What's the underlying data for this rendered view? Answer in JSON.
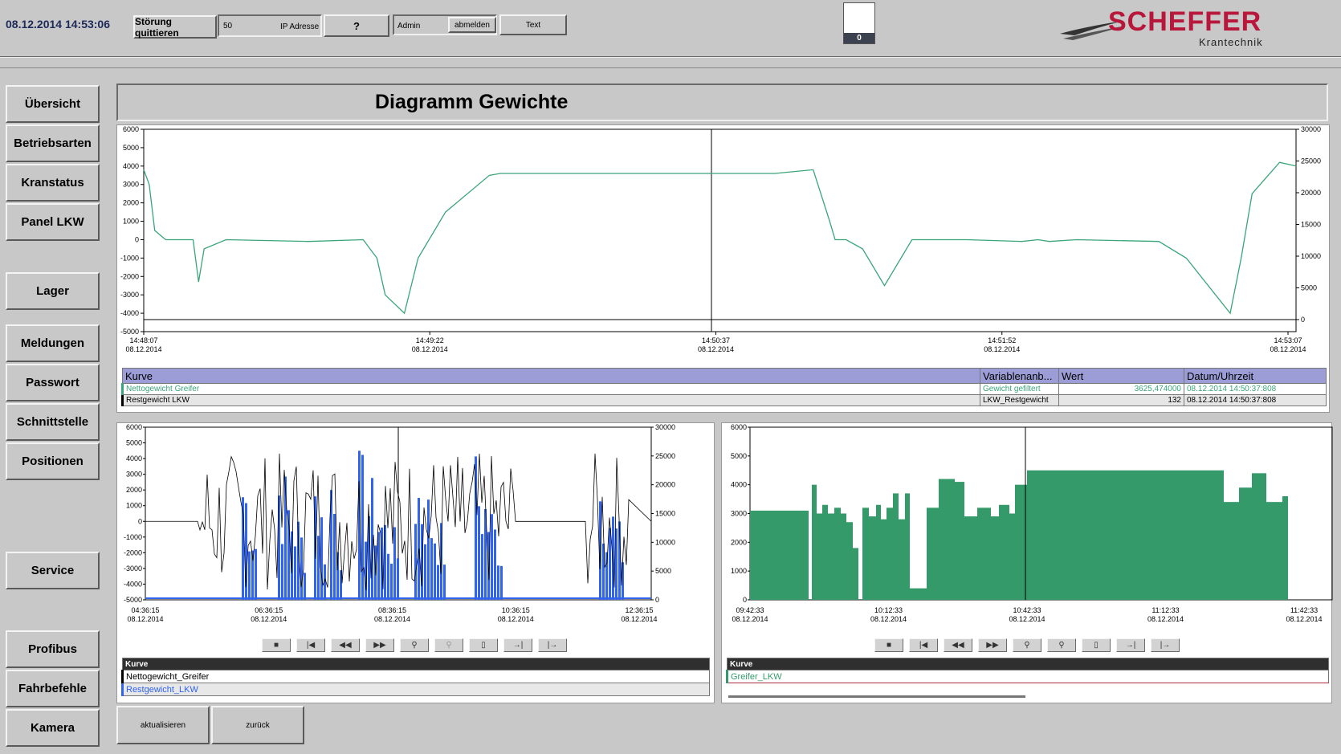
{
  "header": {
    "datetime": "08.12.2014 14:53:06",
    "ack_button": "Störung quittieren",
    "ip_value": "50",
    "ip_label": "IP Adresse",
    "help_button": "?",
    "user": "Admin",
    "logout_button": "abmelden",
    "text_button": "Text",
    "counter": "0",
    "logo_name": "SCHEFFER",
    "logo_sub": "Krantechnik"
  },
  "sidebar": {
    "items": [
      {
        "label": "Übersicht"
      },
      {
        "label": "Betriebsarten"
      },
      {
        "label": "Kranstatus"
      },
      {
        "label": "Panel LKW"
      },
      {
        "label": "Lager"
      },
      {
        "label": "Meldungen"
      },
      {
        "label": "Passwort"
      },
      {
        "label": "Schnittstelle"
      },
      {
        "label": "Positionen"
      },
      {
        "label": "Service"
      },
      {
        "label": "Profibus"
      },
      {
        "label": "Fahrbefehle"
      },
      {
        "label": "Kamera"
      }
    ]
  },
  "page_title": "Diagramm Gewichte",
  "top_chart": {
    "y_left_ticks": [
      "6000",
      "5000",
      "4000",
      "3000",
      "2000",
      "1000",
      "0",
      "-1000",
      "-2000",
      "-3000",
      "-4000",
      "-5000"
    ],
    "y_right_ticks": [
      "30000",
      "25000",
      "20000",
      "15000",
      "10000",
      "5000",
      "0"
    ],
    "x_ticks": [
      {
        "time": "14:48:07",
        "date": "08.12.2014"
      },
      {
        "time": "14:49:22",
        "date": "08.12.2014"
      },
      {
        "time": "14:50:37",
        "date": "08.12.2014"
      },
      {
        "time": "14:51:52",
        "date": "08.12.2014"
      },
      {
        "time": "14:53:07",
        "date": "08.12.2014"
      }
    ]
  },
  "top_legend": {
    "headers": [
      "Kurve",
      "Variablenanb...",
      "Wert",
      "Datum/Uhrzeit"
    ],
    "rows": [
      {
        "name": "Nettogewicht Greifer",
        "var": "Gewicht gefiltert",
        "value": "3625,474000",
        "datetime": "08.12.2014 14:50:37:808"
      },
      {
        "name": "Restgewicht LKW",
        "var": "LKW_Restgewicht",
        "value": "132",
        "datetime": "08.12.2014 14:50:37:808"
      }
    ]
  },
  "left_chart": {
    "y_left_ticks": [
      "6000",
      "5000",
      "4000",
      "3000",
      "2000",
      "1000",
      "0",
      "-1000",
      "-2000",
      "-3000",
      "-4000",
      "-5000"
    ],
    "y_right_ticks": [
      "30000",
      "25000",
      "20000",
      "15000",
      "10000",
      "5000",
      "0"
    ],
    "x_ticks": [
      {
        "time": "04:36:15",
        "date": "08.12.2014"
      },
      {
        "time": "06:36:15",
        "date": "08.12.2014"
      },
      {
        "time": "08:36:15",
        "date": "08.12.2014"
      },
      {
        "time": "10:36:15",
        "date": "08.12.2014"
      },
      {
        "time": "12:36:15",
        "date": "08.12.2014"
      }
    ],
    "legend_header": "Kurve",
    "legend": [
      "Nettogewicht_Greifer",
      "Restgewicht_LKW"
    ]
  },
  "right_chart": {
    "y_ticks": [
      "6000",
      "5000",
      "4000",
      "3000",
      "2000",
      "1000",
      "0"
    ],
    "x_ticks": [
      {
        "time": "09:42:33",
        "date": "08.12.2014"
      },
      {
        "time": "10:12:33",
        "date": "08.12.2014"
      },
      {
        "time": "10:42:33",
        "date": "08.12.2014"
      },
      {
        "time": "11:12:33",
        "date": "08.12.2014"
      },
      {
        "time": "11:42:33",
        "date": "08.12.2014"
      }
    ],
    "legend_header": "Kurve",
    "legend": [
      "Greifer_LKW"
    ]
  },
  "bottom": {
    "refresh_button": "aktualisieren",
    "back_button": "zurück"
  },
  "colors": {
    "green_line": "#3aa57a",
    "blue_bars": "#2f63f0",
    "green_bars": "#359a6a",
    "legend_header": "#9c9cd6"
  },
  "chart_data": [
    {
      "type": "line",
      "series": [
        {
          "name": "Nettogewicht Greifer",
          "x": [
            0,
            2,
            4,
            8,
            18,
            20,
            22,
            30,
            60,
            80,
            85,
            88,
            95,
            100,
            110,
            126,
            130,
            135,
            138,
            142,
            146,
            152,
            170,
            200,
            230,
            244,
            250,
            252,
            256,
            262,
            270,
            280,
            300,
            320,
            326,
            330,
            340,
            370,
            380,
            396,
            400,
            404,
            414,
            420
          ],
          "values": [
            3800,
            3000,
            500,
            0,
            0,
            -2300,
            -500,
            0,
            -100,
            0,
            -1000,
            -3000,
            -4000,
            -1000,
            1500,
            3500,
            3600,
            3600,
            3600,
            3600,
            3600,
            3600,
            3600,
            3600,
            3600,
            3800,
            1000,
            0,
            0,
            -500,
            -2500,
            0,
            0,
            -100,
            0,
            -100,
            0,
            -100,
            -1000,
            -4000,
            -1000,
            2500,
            4200,
            4000
          ]
        }
      ]
    }
  ]
}
